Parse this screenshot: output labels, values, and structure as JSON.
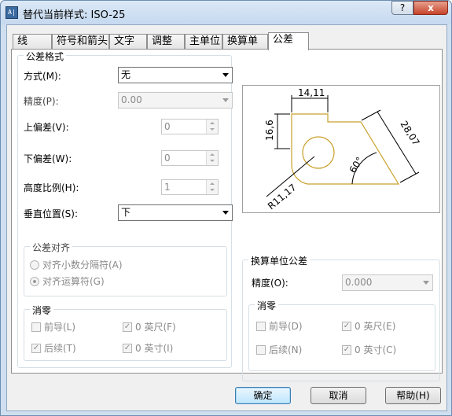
{
  "window": {
    "title": "替代当前样式: ISO-25",
    "help_glyph": "?",
    "close_glyph": "x",
    "app_icon_text": "A|",
    "app_icon": "autocad-dialog-icon"
  },
  "tabs": [
    "线",
    "符号和箭头",
    "文字",
    "调整",
    "主单位",
    "换算单位",
    "公差"
  ],
  "active_tab": "公差",
  "tolerance_format": {
    "group_label": "公差格式",
    "method_label": "方式(M):",
    "method_value": "无",
    "precision_label": "精度(P):",
    "precision_value": "0.00",
    "upper_label": "上偏差(V):",
    "upper_value": "0",
    "lower_label": "下偏差(W):",
    "lower_value": "0",
    "scale_label": "高度比例(H):",
    "scale_value": "1",
    "vpos_label": "垂直位置(S):",
    "vpos_value": "下"
  },
  "alignment": {
    "group_label": "公差对齐",
    "opt_decimal": "对齐小数分隔符(A)",
    "opt_operator": "对齐运算符(G)",
    "selected": "opt_operator"
  },
  "zero_suppression": {
    "group_label": "消零",
    "leading": "前导(L)",
    "trailing": "后续(T)",
    "feet": "0 英尺(F)",
    "inches": "0 英寸(I)",
    "checked": {
      "leading": false,
      "trailing": true,
      "feet": true,
      "inches": true
    }
  },
  "alt_tolerance": {
    "group_label": "换算单位公差",
    "precision_label": "精度(O):",
    "precision_value": "0.000",
    "zero_label": "消零",
    "leading": "前导(D)",
    "trailing": "后续(N)",
    "feet": "0 英尺(E)",
    "inches": "0 英寸(C)",
    "checked": {
      "leading": false,
      "trailing": false,
      "feet": true,
      "inches": true
    }
  },
  "preview": {
    "dim_top": "14,11",
    "dim_left": "16,6",
    "dim_right": "28,07",
    "angle": "60°",
    "radius": "R11,17",
    "line_color": "#000000",
    "shape_color": "#c8a02a"
  },
  "buttons": {
    "ok": "确定",
    "cancel": "取消",
    "help": "帮助(H)"
  }
}
